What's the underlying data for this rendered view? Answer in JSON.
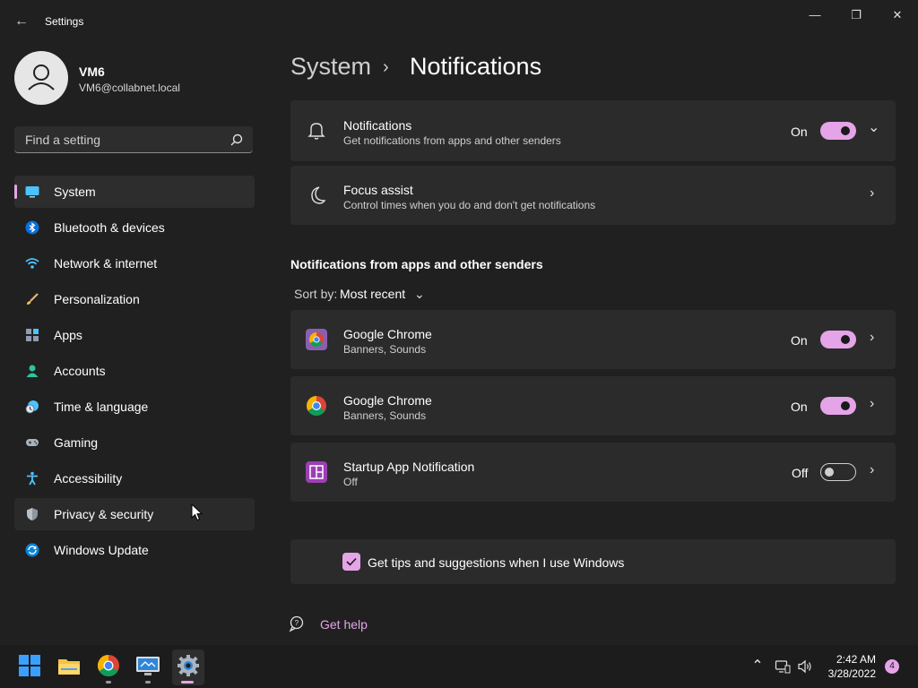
{
  "window": {
    "title": "Settings",
    "back_glyph": "←",
    "minimize_glyph": "—",
    "maximize_glyph": "❐",
    "close_glyph": "✕"
  },
  "user": {
    "name": "VM6",
    "email": "VM6@collabnet.local"
  },
  "search": {
    "placeholder": "Find a setting"
  },
  "nav": {
    "items": [
      {
        "label": "System",
        "icon": "system-monitor-icon",
        "active": true
      },
      {
        "label": "Bluetooth & devices",
        "icon": "bluetooth-icon"
      },
      {
        "label": "Network & internet",
        "icon": "wifi-icon"
      },
      {
        "label": "Personalization",
        "icon": "brush-icon"
      },
      {
        "label": "Apps",
        "icon": "apps-icon"
      },
      {
        "label": "Accounts",
        "icon": "person-icon"
      },
      {
        "label": "Time & language",
        "icon": "clock-globe-icon"
      },
      {
        "label": "Gaming",
        "icon": "gamepad-icon"
      },
      {
        "label": "Accessibility",
        "icon": "accessibility-icon"
      },
      {
        "label": "Privacy & security",
        "icon": "shield-icon",
        "hover": true
      },
      {
        "label": "Windows Update",
        "icon": "update-icon"
      }
    ]
  },
  "breadcrumb": {
    "parent": "System",
    "separator": "›",
    "current": "Notifications"
  },
  "notifications_card": {
    "title": "Notifications",
    "subtitle": "Get notifications from apps and other senders",
    "state": "On",
    "expand_glyph": "⌄"
  },
  "focus_card": {
    "title": "Focus assist",
    "subtitle": "Control times when you do and don't get notifications",
    "chevron": "›"
  },
  "senders": {
    "heading": "Notifications from apps and other senders",
    "sort_label": "Sort by:",
    "sort_value": "Most recent",
    "sort_chevron": "⌄",
    "apps": [
      {
        "name": "Google Chrome",
        "detail": "Banners, Sounds",
        "state": "On",
        "enabled": true,
        "icon": "chrome-icon"
      },
      {
        "name": "Google Chrome",
        "detail": "Banners, Sounds",
        "state": "On",
        "enabled": true,
        "icon": "chrome-icon"
      },
      {
        "name": "Startup App Notification",
        "detail": "Off",
        "state": "Off",
        "enabled": false,
        "icon": "startup-app-icon"
      }
    ],
    "chevron": "›"
  },
  "tips": {
    "label": "Get tips and suggestions when I use Windows",
    "checked": true
  },
  "help": {
    "label": "Get help"
  },
  "taskbar": {
    "time": "2:42 AM",
    "date": "3/28/2022",
    "notification_count": "4",
    "tray_up_glyph": "⌃"
  },
  "colors": {
    "accent": "#e5a4e8",
    "background": "#202020",
    "card": "#2b2b2b"
  }
}
